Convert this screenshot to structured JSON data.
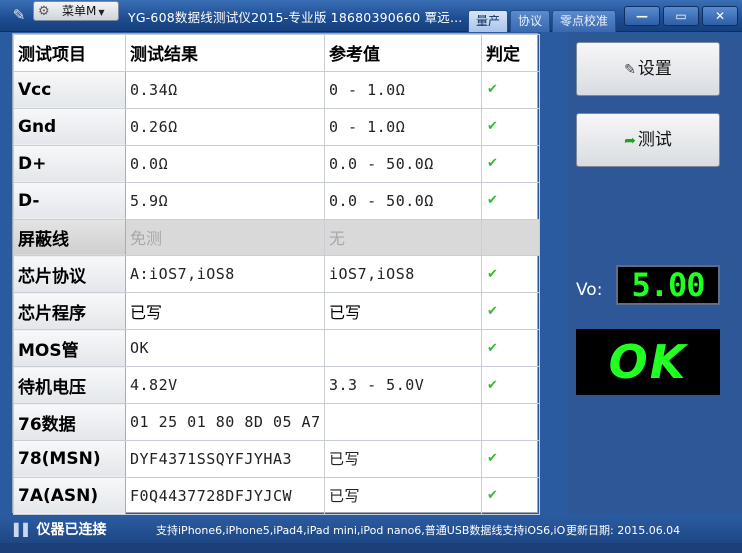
{
  "window": {
    "menu_label": "菜单M",
    "title": "YG-608数据线测试仪2015-专业版 18680390660 覃远...",
    "tabs": [
      {
        "label": "量产",
        "active": true
      },
      {
        "label": "协议",
        "active": false
      },
      {
        "label": "零点校准",
        "active": false
      }
    ],
    "controls": {
      "minimize": "—",
      "maximize": "▭",
      "close": "✕"
    }
  },
  "table": {
    "headers": [
      "测试项目",
      "测试结果",
      "参考值",
      "判定"
    ],
    "rows": [
      {
        "item": "Vcc",
        "result": "0.34Ω",
        "reference": "0 - 1.0Ω",
        "pass": true
      },
      {
        "item": "Gnd",
        "result": "0.26Ω",
        "reference": "0 - 1.0Ω",
        "pass": true
      },
      {
        "item": "D+",
        "result": "0.0Ω",
        "reference": "0.0 - 50.0Ω",
        "pass": true
      },
      {
        "item": "D-",
        "result": "5.9Ω",
        "reference": "0.0 - 50.0Ω",
        "pass": true
      },
      {
        "item": "屏蔽线",
        "result": "免测",
        "reference": "无",
        "pass": null,
        "disabled": true
      },
      {
        "item": "芯片协议",
        "result": "A:iOS7,iOS8",
        "reference": "iOS7,iOS8",
        "pass": true
      },
      {
        "item": "芯片程序",
        "result": "已写",
        "reference": "已写",
        "pass": true
      },
      {
        "item": "MOS管",
        "result": "OK",
        "reference": "",
        "pass": true
      },
      {
        "item": "待机电压",
        "result": "4.82V",
        "reference": "3.3 - 5.0V",
        "pass": true
      },
      {
        "item": "76数据",
        "result": "01 25 01 80 8D 05 A7",
        "reference": "",
        "pass": null
      },
      {
        "item": "78(MSN)",
        "result": "DYF4371SSQYFJYHA3",
        "reference": "已写",
        "pass": true
      },
      {
        "item": "7A(ASN)",
        "result": "F0Q4437728DFJYJCW",
        "reference": "已写",
        "pass": true
      }
    ],
    "check_glyph": "✔"
  },
  "panel": {
    "settings_label": "设置",
    "test_label": "测试",
    "vo_label": "Vo:",
    "vo_value": "5.00",
    "result_text": "OK",
    "colors": {
      "led": "#22ff22",
      "background": "#2d5797"
    }
  },
  "status": {
    "connection": "仪器已连接",
    "message": "支持iPhone6,iPhone5,iPad4,iPad mini,iPod nano6,普通USB数据线支持iOS6,iOS7,iOS8",
    "update_date": "更新日期: 2015.06.04"
  }
}
